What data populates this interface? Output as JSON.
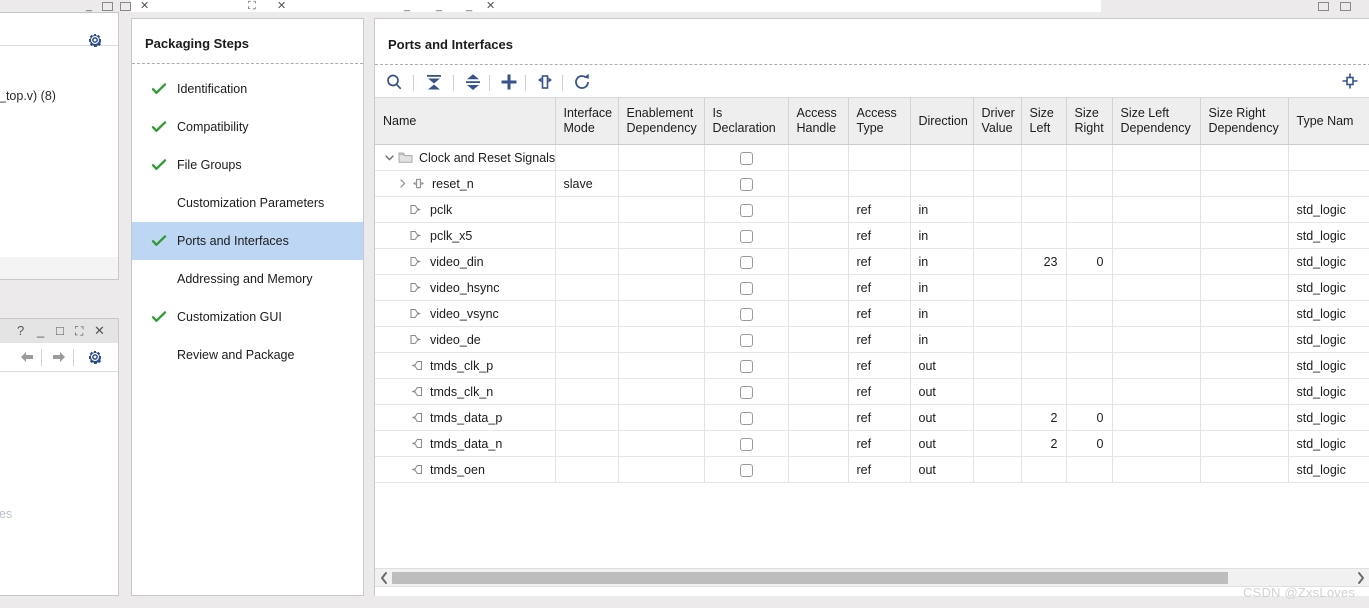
{
  "window_controls": {
    "left_panel_glyphs": [
      "?",
      "_",
      "□",
      "⛶",
      "✕"
    ],
    "bottom_panel_glyphs": [
      "?",
      "_",
      "□",
      "⛶",
      "✕"
    ]
  },
  "left_top_panel": {
    "gear_icon": "gear-icon",
    "tree_text": "_top.v) (8)"
  },
  "left_bottom_panel": {
    "back_icon": "arrow-left-icon",
    "forward_icon": "arrow-right-icon",
    "gear_icon": "gear-icon",
    "faint_text": "es"
  },
  "steps_panel": {
    "title": "Packaging Steps",
    "items": [
      {
        "label": "Identification",
        "checked": true,
        "selected": false
      },
      {
        "label": "Compatibility",
        "checked": true,
        "selected": false
      },
      {
        "label": "File Groups",
        "checked": true,
        "selected": false
      },
      {
        "label": "Customization Parameters",
        "checked": false,
        "selected": false
      },
      {
        "label": "Ports and Interfaces",
        "checked": true,
        "selected": true
      },
      {
        "label": "Addressing and Memory",
        "checked": false,
        "selected": false
      },
      {
        "label": "Customization GUI",
        "checked": true,
        "selected": false
      },
      {
        "label": "Review and Package",
        "checked": false,
        "selected": false
      }
    ],
    "check_color": "#2e9c2e",
    "selected_color": "#bcd6f3"
  },
  "main_panel": {
    "title": "Ports and Interfaces",
    "toolbar": [
      {
        "name": "search-icon",
        "tooltip": "Search"
      },
      {
        "name": "collapse-all-icon",
        "tooltip": "Collapse All"
      },
      {
        "name": "expand-all-icon",
        "tooltip": "Expand All"
      },
      {
        "name": "add-icon",
        "tooltip": "Add"
      },
      {
        "name": "interface-port-icon",
        "tooltip": "Auto Infer Interface"
      },
      {
        "name": "refresh-icon",
        "tooltip": "Refresh"
      }
    ],
    "pin_icon": "pin-icon",
    "toolbar_color": "#37538e",
    "columns": [
      "Name",
      "Interface Mode",
      "Enablement Dependency",
      "Is Declaration",
      "Access Handle",
      "Access Type",
      "Direction",
      "Driver Value",
      "Size Left",
      "Size Right",
      "Size Left Dependency",
      "Size Right Dependency",
      "Type Nam"
    ],
    "rows": [
      {
        "name": "Clock and Reset Signals",
        "icon": "folder-icon",
        "expander": "chevron-down-icon",
        "indent": 0,
        "interface_mode": "",
        "enablement_dependency": "",
        "is_declaration": false,
        "access_handle": "",
        "access_type": "",
        "direction": "",
        "driver_value": "",
        "size_left": "",
        "size_right": "",
        "size_left_dep": "",
        "size_right_dep": "",
        "type_name": ""
      },
      {
        "name": "reset_n",
        "icon": "interface-port-icon",
        "expander": "chevron-right-icon",
        "indent": 1,
        "interface_mode": "slave",
        "enablement_dependency": "",
        "is_declaration": false,
        "access_handle": "",
        "access_type": "",
        "direction": "",
        "driver_value": "",
        "size_left": "",
        "size_right": "",
        "size_left_dep": "",
        "size_right_dep": "",
        "type_name": ""
      },
      {
        "name": "pclk",
        "icon": "input-port-icon",
        "expander": "",
        "indent": 1,
        "interface_mode": "",
        "enablement_dependency": "",
        "is_declaration": false,
        "access_handle": "",
        "access_type": "ref",
        "direction": "in",
        "driver_value": "",
        "size_left": "",
        "size_right": "",
        "size_left_dep": "",
        "size_right_dep": "",
        "type_name": "std_logic"
      },
      {
        "name": "pclk_x5",
        "icon": "input-port-icon",
        "expander": "",
        "indent": 1,
        "interface_mode": "",
        "enablement_dependency": "",
        "is_declaration": false,
        "access_handle": "",
        "access_type": "ref",
        "direction": "in",
        "driver_value": "",
        "size_left": "",
        "size_right": "",
        "size_left_dep": "",
        "size_right_dep": "",
        "type_name": "std_logic"
      },
      {
        "name": "video_din",
        "icon": "input-port-icon",
        "expander": "",
        "indent": 1,
        "interface_mode": "",
        "enablement_dependency": "",
        "is_declaration": false,
        "access_handle": "",
        "access_type": "ref",
        "direction": "in",
        "driver_value": "",
        "size_left": "23",
        "size_right": "0",
        "size_left_dep": "",
        "size_right_dep": "",
        "type_name": "std_logic"
      },
      {
        "name": "video_hsync",
        "icon": "input-port-icon",
        "expander": "",
        "indent": 1,
        "interface_mode": "",
        "enablement_dependency": "",
        "is_declaration": false,
        "access_handle": "",
        "access_type": "ref",
        "direction": "in",
        "driver_value": "",
        "size_left": "",
        "size_right": "",
        "size_left_dep": "",
        "size_right_dep": "",
        "type_name": "std_logic"
      },
      {
        "name": "video_vsync",
        "icon": "input-port-icon",
        "expander": "",
        "indent": 1,
        "interface_mode": "",
        "enablement_dependency": "",
        "is_declaration": false,
        "access_handle": "",
        "access_type": "ref",
        "direction": "in",
        "driver_value": "",
        "size_left": "",
        "size_right": "",
        "size_left_dep": "",
        "size_right_dep": "",
        "type_name": "std_logic"
      },
      {
        "name": "video_de",
        "icon": "input-port-icon",
        "expander": "",
        "indent": 1,
        "interface_mode": "",
        "enablement_dependency": "",
        "is_declaration": false,
        "access_handle": "",
        "access_type": "ref",
        "direction": "in",
        "driver_value": "",
        "size_left": "",
        "size_right": "",
        "size_left_dep": "",
        "size_right_dep": "",
        "type_name": "std_logic"
      },
      {
        "name": "tmds_clk_p",
        "icon": "output-port-icon",
        "expander": "",
        "indent": 1,
        "interface_mode": "",
        "enablement_dependency": "",
        "is_declaration": false,
        "access_handle": "",
        "access_type": "ref",
        "direction": "out",
        "driver_value": "",
        "size_left": "",
        "size_right": "",
        "size_left_dep": "",
        "size_right_dep": "",
        "type_name": "std_logic"
      },
      {
        "name": "tmds_clk_n",
        "icon": "output-port-icon",
        "expander": "",
        "indent": 1,
        "interface_mode": "",
        "enablement_dependency": "",
        "is_declaration": false,
        "access_handle": "",
        "access_type": "ref",
        "direction": "out",
        "driver_value": "",
        "size_left": "",
        "size_right": "",
        "size_left_dep": "",
        "size_right_dep": "",
        "type_name": "std_logic"
      },
      {
        "name": "tmds_data_p",
        "icon": "output-port-icon",
        "expander": "",
        "indent": 1,
        "interface_mode": "",
        "enablement_dependency": "",
        "is_declaration": false,
        "access_handle": "",
        "access_type": "ref",
        "direction": "out",
        "driver_value": "",
        "size_left": "2",
        "size_right": "0",
        "size_left_dep": "",
        "size_right_dep": "",
        "type_name": "std_logic"
      },
      {
        "name": "tmds_data_n",
        "icon": "output-port-icon",
        "expander": "",
        "indent": 1,
        "interface_mode": "",
        "enablement_dependency": "",
        "is_declaration": false,
        "access_handle": "",
        "access_type": "ref",
        "direction": "out",
        "driver_value": "",
        "size_left": "2",
        "size_right": "0",
        "size_left_dep": "",
        "size_right_dep": "",
        "type_name": "std_logic"
      },
      {
        "name": "tmds_oen",
        "icon": "output-port-icon",
        "expander": "",
        "indent": 1,
        "interface_mode": "",
        "enablement_dependency": "",
        "is_declaration": false,
        "access_handle": "",
        "access_type": "ref",
        "direction": "out",
        "driver_value": "",
        "size_left": "",
        "size_right": "",
        "size_left_dep": "",
        "size_right_dep": "",
        "type_name": "std_logic"
      }
    ],
    "scrollbar": {
      "left_arrow": "chevron-left-icon",
      "right_arrow": "chevron-right-icon",
      "thumb_percent": 87
    }
  },
  "watermark": "CSDN @ZxsLoves"
}
